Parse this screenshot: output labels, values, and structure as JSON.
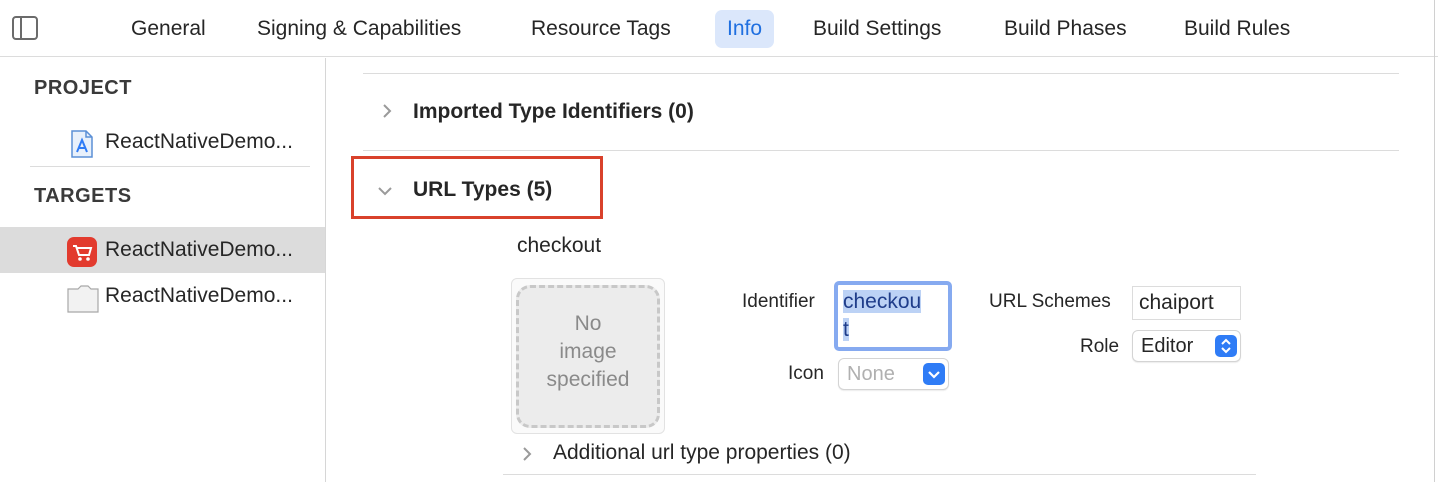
{
  "tabs": [
    {
      "label": "General",
      "active": false
    },
    {
      "label": "Signing & Capabilities",
      "active": false
    },
    {
      "label": "Resource Tags",
      "active": false
    },
    {
      "label": "Info",
      "active": true
    },
    {
      "label": "Build Settings",
      "active": false
    },
    {
      "label": "Build Phases",
      "active": false
    },
    {
      "label": "Build Rules",
      "active": false
    }
  ],
  "sidebar": {
    "project_header": "PROJECT",
    "project_item": "ReactNativeDemo...",
    "targets_header": "TARGETS",
    "targets": [
      {
        "label": "ReactNativeDemo...",
        "icon": "app-cart-icon",
        "selected": true
      },
      {
        "label": "ReactNativeDemo...",
        "icon": "test-bundle-icon",
        "selected": false
      }
    ]
  },
  "main": {
    "imported_types": "Imported Type Identifiers (0)",
    "url_types": "URL Types (5)",
    "url_type": {
      "name": "checkout",
      "image_placeholder": [
        "No",
        "image",
        "specified"
      ],
      "identifier_label": "Identifier",
      "identifier_value_line1": "checkou",
      "identifier_value_line2": "t",
      "icon_label": "Icon",
      "icon_placeholder": "None",
      "url_schemes_label": "URL Schemes",
      "url_schemes_value": "chaiport",
      "role_label": "Role",
      "role_value": "Editor"
    },
    "additional": "Additional url type properties (0)"
  },
  "colors": {
    "accent": "#2f7cf6",
    "active_tab_bg": "#dbe7fb",
    "active_tab_text": "#1f6fe0",
    "highlight": "#d9412b",
    "selected_row": "#dcdcdc"
  }
}
